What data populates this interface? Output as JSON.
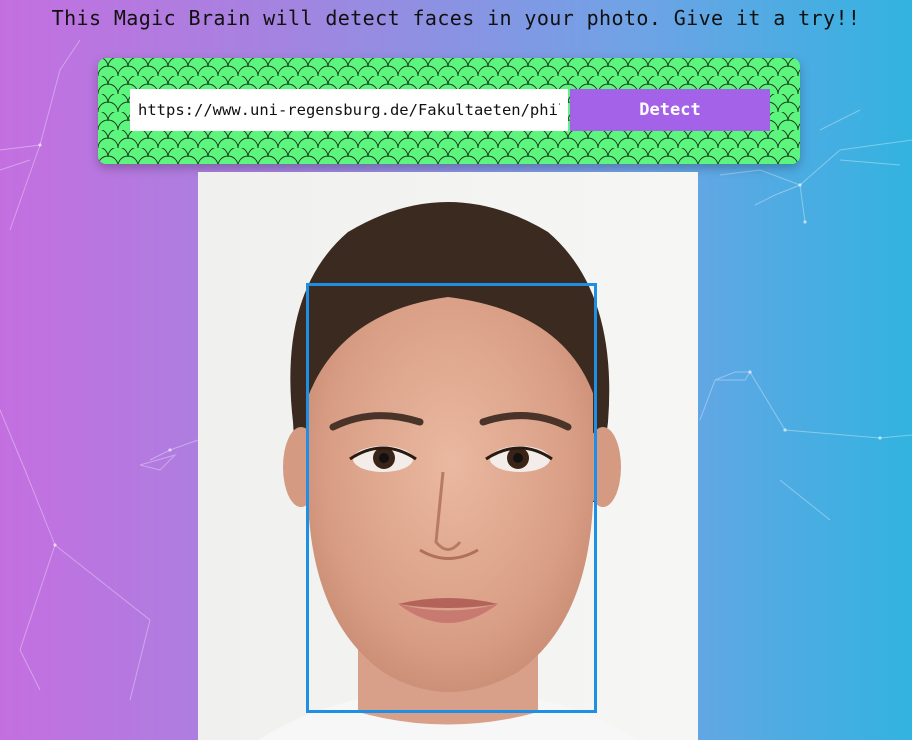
{
  "page": {
    "tagline": "This Magic Brain will detect faces in your photo. Give it a try!!"
  },
  "form": {
    "url_value": "https://www.uni-regensburg.de/Fakultaeten/phil_Fak_II/Psychologie/Psy_II/beautycheck/english/durchschnittsgesichter/w(01-64)_gr.jpg",
    "detect_label": "Detect"
  },
  "photo": {
    "alt": "Face photo"
  },
  "colors": {
    "button": "#a362e8",
    "panel_pattern": "#5cf57e",
    "face_box": "#1f8fe6"
  }
}
